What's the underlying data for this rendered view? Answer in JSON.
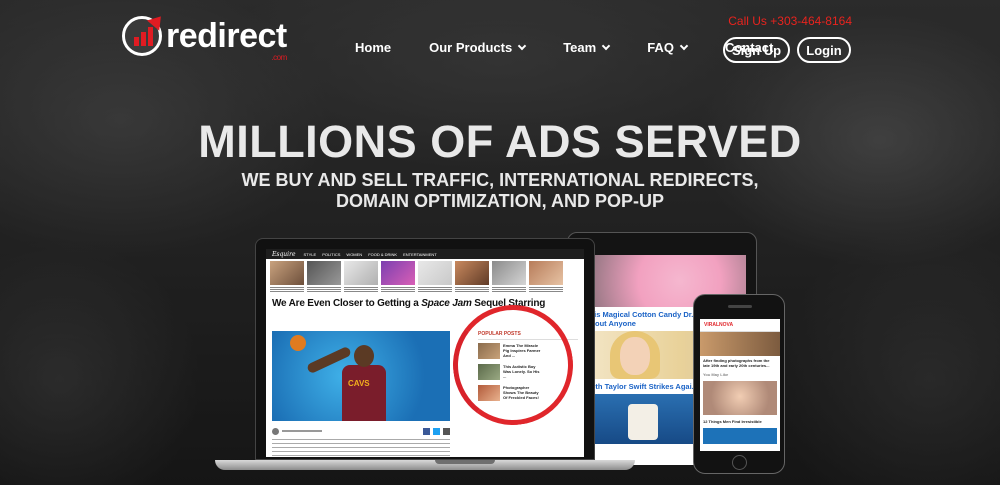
{
  "header": {
    "logo_text": "redirect",
    "logo_sub": ".com",
    "call_us": "Call Us +303-464-8164",
    "nav": [
      {
        "label": "Home",
        "dropdown": false
      },
      {
        "label": "Our Products",
        "dropdown": true
      },
      {
        "label": "Team",
        "dropdown": true
      },
      {
        "label": "FAQ",
        "dropdown": true
      },
      {
        "label": "Contact",
        "dropdown": false
      }
    ],
    "signup_label": "Sign Up",
    "login_label": "Login"
  },
  "hero": {
    "title": "MILLIONS OF ADS SERVED",
    "subtitle_line1": "WE BUY AND SELL TRAFFIC, INTERNATIONAL REDIRECTS,",
    "subtitle_line2": "DOMAIN OPTIMIZATION, AND POP-UP"
  },
  "laptop_site": {
    "brand": "Esquire",
    "menu": [
      "STYLE",
      "POLITICS",
      "WOMEN",
      "FOOD & DRINK",
      "ENTERTAINMENT"
    ],
    "article_title_pre": "We Are Even Closer to Getting a ",
    "article_title_italic": "Space Jam",
    "article_title_post": " Sequel Starring",
    "popular_heading": "POPULAR POSTS",
    "popular_posts": [
      "Emma The Miracle Pig Inspires Farmer And ...",
      "This Autistic Boy Was Lonely. So His ...",
      "Photographer Shows The Beauty Of Freckled Faces!"
    ]
  },
  "tablet_site": {
    "caption1": "This Magical Cotton Candy Dr... Shock Just About Anyone",
    "caption2": "Goth Taylor Swift Strikes Agai..."
  },
  "phone_site": {
    "brand": "VIRALNOVA",
    "text1": "After finding photographs from the late 19th and early 20th centuries...",
    "text2": "You May Like",
    "text3": "12 Things Men Find Irresistible"
  },
  "colors": {
    "accent_red": "#e01b22",
    "call_us": "#e8231e",
    "link_blue": "#1b63c6"
  }
}
